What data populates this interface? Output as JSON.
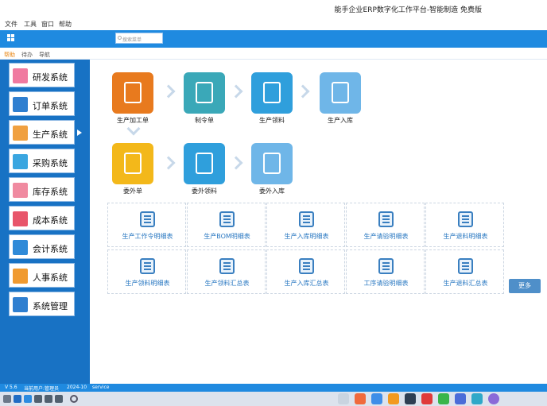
{
  "window": {
    "title": "能手企业ERP数字化工作平台-智能制造 免费版"
  },
  "menu": [
    "文件",
    "工具",
    "窗口",
    "帮助"
  ],
  "toolbar": {
    "search_placeholder": "搜索菜单"
  },
  "tabs": [
    "帮助",
    "待办",
    "导航"
  ],
  "sidebar": {
    "items": [
      {
        "label": "研发系统",
        "icon": "rd-icon",
        "color": "#f07aa0"
      },
      {
        "label": "订单系统",
        "icon": "order-icon",
        "color": "#2f7fd0"
      },
      {
        "label": "生产系统",
        "icon": "production-icon",
        "color": "#f0a040"
      },
      {
        "label": "采购系统",
        "icon": "purchase-icon",
        "color": "#3aa6e0"
      },
      {
        "label": "库存系统",
        "icon": "inventory-icon",
        "color": "#f08aa0"
      },
      {
        "label": "成本系统",
        "icon": "cost-icon",
        "color": "#e8556a"
      },
      {
        "label": "会计系统",
        "icon": "accounting-icon",
        "color": "#2f8ad8"
      },
      {
        "label": "人事系统",
        "icon": "hr-icon",
        "color": "#f09a30"
      },
      {
        "label": "系统管理",
        "icon": "settings-icon",
        "color": "#2f7fd0"
      }
    ],
    "active_index": 2
  },
  "flow": [
    {
      "label": "生产加工单",
      "icon": "work-order-icon",
      "color": "#e87a1e"
    },
    {
      "label": "制令单",
      "icon": "manufacturing-order-icon",
      "color": "#3aa8b8"
    },
    {
      "label": "生产领料",
      "icon": "material-issue-icon",
      "color": "#2f9fdc"
    },
    {
      "label": "生产入库",
      "icon": "production-receipt-icon",
      "color": "#6fb6e8"
    },
    {
      "label": "委外单",
      "icon": "outsource-order-icon",
      "color": "#f3b81a"
    },
    {
      "label": "委外领料",
      "icon": "outsource-issue-icon",
      "color": "#2f9fdc"
    },
    {
      "label": "委外入库",
      "icon": "outsource-receipt-icon",
      "color": "#6fb6e8"
    }
  ],
  "reports": [
    "生产工作令明细表",
    "生产BOM明细表",
    "生产入库明细表",
    "生产请验明细表",
    "生产退料明细表",
    "生产领料明细表",
    "生产领料汇总表",
    "生产入库汇总表",
    "工序请验明细表",
    "生产退料汇总表"
  ],
  "more_label": "更多",
  "status": {
    "version": "V 5.6",
    "company": "当前用户:管理员",
    "date": "2024-10",
    "user": "service"
  }
}
